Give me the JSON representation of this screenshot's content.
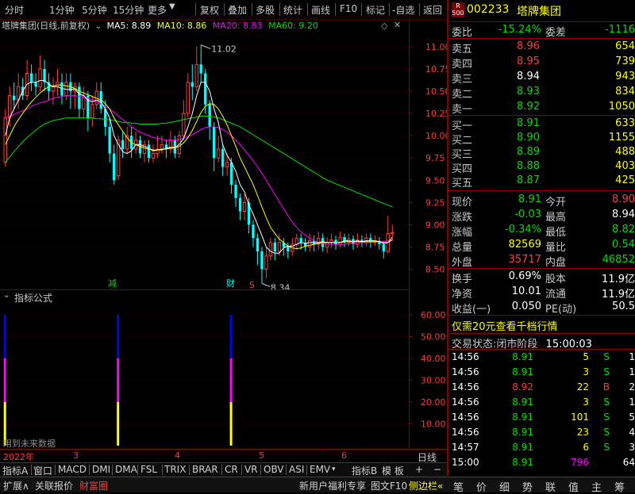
{
  "toolbar": {
    "left_items": [
      "分时",
      "1分钟",
      "5分钟",
      "15分钟",
      "更多"
    ],
    "right_items": [
      "复权",
      "叠加",
      "多股",
      "统计",
      "画线",
      "F10",
      "标记",
      "-自选",
      "返回"
    ]
  },
  "kline": {
    "name_label": "塔牌集团(日线,前复权)",
    "ma5": "MA5: 8.89",
    "ma10": "MA10: 8.86",
    "ma20": "MA20: 8.83",
    "ma60": "MA60: 9.20",
    "high_label": "11.02",
    "low_label": "8.34",
    "marker_jian": "减",
    "marker_cai": "财",
    "marker_s": "S",
    "colors": {
      "ma5": "#ffffff",
      "ma10": "#ffff00",
      "ma20": "#ff00ff",
      "ma60": "#00e000",
      "up": "#ff3c3c",
      "down": "#00ffff"
    }
  },
  "chart_data": {
    "type": "candlestick",
    "ylim": [
      8.3,
      11.15
    ],
    "yticks": [
      "11.00",
      "10.75",
      "10.50",
      "10.25",
      "10.00",
      "9.75",
      "9.50",
      "9.25",
      "9.00",
      "8.75",
      "8.50"
    ],
    "candles": [
      [
        9.7,
        10.2,
        10.3,
        9.65
      ],
      [
        10.2,
        10.45,
        10.55,
        10.1
      ],
      [
        10.45,
        10.4,
        10.6,
        10.3
      ],
      [
        10.4,
        10.55,
        10.7,
        10.3
      ],
      [
        10.55,
        10.45,
        10.65,
        10.4
      ],
      [
        10.45,
        10.7,
        10.85,
        10.4
      ],
      [
        10.7,
        10.6,
        10.8,
        10.5
      ],
      [
        10.6,
        10.55,
        10.7,
        10.45
      ],
      [
        10.55,
        10.75,
        10.9,
        10.5
      ],
      [
        10.75,
        10.6,
        10.85,
        10.5
      ],
      [
        10.6,
        10.5,
        10.7,
        10.4
      ],
      [
        10.5,
        10.55,
        10.65,
        10.35
      ],
      [
        10.55,
        10.6,
        10.75,
        10.45
      ],
      [
        10.6,
        10.45,
        10.7,
        10.35
      ],
      [
        10.45,
        10.6,
        10.7,
        10.4
      ],
      [
        10.6,
        10.5,
        10.7,
        10.3
      ],
      [
        10.5,
        10.55,
        10.6,
        10.3
      ],
      [
        10.55,
        10.3,
        10.6,
        10.2
      ],
      [
        10.3,
        10.45,
        10.55,
        10.2
      ],
      [
        10.45,
        10.2,
        10.5,
        10.05
      ],
      [
        10.2,
        10.35,
        10.45,
        10.1
      ],
      [
        10.35,
        10.5,
        10.6,
        10.3
      ],
      [
        10.5,
        10.3,
        10.6,
        10.25
      ],
      [
        10.3,
        10.1,
        10.4,
        10.0
      ],
      [
        10.1,
        9.8,
        10.2,
        9.7
      ],
      [
        9.8,
        9.5,
        9.9,
        9.45
      ],
      [
        9.55,
        9.95,
        10.0,
        9.5
      ],
      [
        9.95,
        9.85,
        10.05,
        9.75
      ],
      [
        9.85,
        10.0,
        10.1,
        9.8
      ],
      [
        10.0,
        9.85,
        10.1,
        9.75
      ],
      [
        9.85,
        9.95,
        10.05,
        9.8
      ],
      [
        9.95,
        9.8,
        10.0,
        9.75
      ],
      [
        9.8,
        9.9,
        9.95,
        9.7
      ],
      [
        9.9,
        9.75,
        9.95,
        9.7
      ],
      [
        9.75,
        9.8,
        9.9,
        9.7
      ],
      [
        9.8,
        9.85,
        10.0,
        9.75
      ],
      [
        9.85,
        9.9,
        10.0,
        9.8
      ],
      [
        9.9,
        9.85,
        9.95,
        9.75
      ],
      [
        9.85,
        9.95,
        10.05,
        9.8
      ],
      [
        9.95,
        9.8,
        10.0,
        9.75
      ],
      [
        9.8,
        10.0,
        10.05,
        9.75
      ],
      [
        10.0,
        10.25,
        10.4,
        9.95
      ],
      [
        10.25,
        10.6,
        10.7,
        10.2
      ],
      [
        10.6,
        10.55,
        10.8,
        10.4
      ],
      [
        10.55,
        10.8,
        11.0,
        10.5
      ],
      [
        10.8,
        10.7,
        11.02,
        10.6
      ],
      [
        10.7,
        10.35,
        10.75,
        10.25
      ],
      [
        10.35,
        10.1,
        10.4,
        9.95
      ],
      [
        10.1,
        9.75,
        10.15,
        9.6
      ],
      [
        9.75,
        9.85,
        10.0,
        9.7
      ],
      [
        9.85,
        9.65,
        9.9,
        9.55
      ],
      [
        9.65,
        9.7,
        9.8,
        9.55
      ],
      [
        9.7,
        9.45,
        9.75,
        9.35
      ],
      [
        9.45,
        9.3,
        9.5,
        9.2
      ],
      [
        9.3,
        9.15,
        9.35,
        9.05
      ],
      [
        9.15,
        9.25,
        9.35,
        9.05
      ],
      [
        9.25,
        9.0,
        9.3,
        8.9
      ],
      [
        9.0,
        8.85,
        9.05,
        8.75
      ],
      [
        8.85,
        8.7,
        8.9,
        8.55
      ],
      [
        8.7,
        8.5,
        8.75,
        8.34
      ],
      [
        8.5,
        8.65,
        8.75,
        8.4
      ],
      [
        8.65,
        8.8,
        8.85,
        8.6
      ],
      [
        8.8,
        8.7,
        8.85,
        8.6
      ],
      [
        8.7,
        8.8,
        8.9,
        8.65
      ],
      [
        8.8,
        8.75,
        8.85,
        8.65
      ],
      [
        8.75,
        8.7,
        8.8,
        8.62
      ],
      [
        8.7,
        8.78,
        8.85,
        8.65
      ],
      [
        8.78,
        8.85,
        8.9,
        8.72
      ],
      [
        8.85,
        8.8,
        8.9,
        8.72
      ],
      [
        8.8,
        8.75,
        8.85,
        8.7
      ],
      [
        8.75,
        8.82,
        8.9,
        8.7
      ],
      [
        8.82,
        8.78,
        8.88,
        8.7
      ],
      [
        8.78,
        8.85,
        8.92,
        8.72
      ],
      [
        8.85,
        8.75,
        8.9,
        8.7
      ],
      [
        8.75,
        8.8,
        8.86,
        8.68
      ],
      [
        8.8,
        8.83,
        8.9,
        8.74
      ],
      [
        8.83,
        8.78,
        8.88,
        8.72
      ],
      [
        8.78,
        8.86,
        8.92,
        8.74
      ],
      [
        8.86,
        8.8,
        8.9,
        8.75
      ],
      [
        8.8,
        8.84,
        8.9,
        8.76
      ],
      [
        8.84,
        8.78,
        8.88,
        8.72
      ],
      [
        8.78,
        8.83,
        8.9,
        8.74
      ],
      [
        8.83,
        8.8,
        8.88,
        8.75
      ],
      [
        8.8,
        8.85,
        8.9,
        8.76
      ],
      [
        8.85,
        8.8,
        8.9,
        8.74
      ],
      [
        8.8,
        8.82,
        8.88,
        8.76
      ],
      [
        8.82,
        8.78,
        8.86,
        8.72
      ],
      [
        8.78,
        8.7,
        8.82,
        8.62
      ],
      [
        8.7,
        8.9,
        9.1,
        8.68
      ],
      [
        8.9,
        8.91,
        9.0,
        8.82
      ]
    ],
    "ma5": [
      10.0,
      10.2,
      10.3,
      10.4,
      10.5,
      10.58,
      10.6,
      10.6,
      10.62,
      10.62,
      10.58,
      10.55,
      10.55,
      10.53,
      10.52,
      10.52,
      10.52,
      10.47,
      10.45,
      10.4,
      10.38,
      10.4,
      10.38,
      10.3,
      10.2,
      10.0,
      9.9,
      9.82,
      9.8,
      9.83,
      9.9,
      9.9,
      9.88,
      9.86,
      9.83,
      9.84,
      9.84,
      9.86,
      9.87,
      9.87,
      9.9,
      9.97,
      10.1,
      10.25,
      10.45,
      10.6,
      10.6,
      10.5,
      10.3,
      10.15,
      9.9,
      9.78,
      9.7,
      9.6,
      9.45,
      9.37,
      9.22,
      9.12,
      9.0,
      8.88,
      8.75,
      8.7,
      8.68,
      8.68,
      8.74,
      8.76,
      8.76,
      8.78,
      8.8,
      8.79,
      8.8,
      8.8,
      8.8,
      8.81,
      8.8,
      8.8,
      8.8,
      8.8,
      8.82,
      8.82,
      8.81,
      8.82,
      8.81,
      8.82,
      8.82,
      8.82,
      8.81,
      8.79,
      8.8,
      8.83
    ],
    "ma10": [
      9.9,
      10.0,
      10.1,
      10.18,
      10.25,
      10.32,
      10.38,
      10.43,
      10.48,
      10.52,
      10.55,
      10.56,
      10.57,
      10.57,
      10.56,
      10.55,
      10.53,
      10.5,
      10.48,
      10.46,
      10.44,
      10.42,
      10.4,
      10.36,
      10.3,
      10.2,
      10.12,
      10.05,
      9.98,
      9.92,
      9.9,
      9.88,
      9.86,
      9.85,
      9.84,
      9.84,
      9.85,
      9.85,
      9.86,
      9.86,
      9.88,
      9.92,
      9.98,
      10.06,
      10.16,
      10.26,
      10.33,
      10.36,
      10.35,
      10.3,
      10.22,
      10.12,
      10.0,
      9.88,
      9.75,
      9.65,
      9.55,
      9.45,
      9.33,
      9.2,
      9.08,
      8.97,
      8.9,
      8.84,
      8.8,
      8.76,
      8.74,
      8.73,
      8.74,
      8.76,
      8.77,
      8.78,
      8.79,
      8.8,
      8.8,
      8.8,
      8.8,
      8.8,
      8.81,
      8.81,
      8.81,
      8.81,
      8.81,
      8.81,
      8.81,
      8.81,
      8.81,
      8.8,
      8.8,
      8.86
    ],
    "ma20": [
      10.2,
      10.22,
      10.24,
      10.26,
      10.28,
      10.3,
      10.33,
      10.35,
      10.37,
      10.38,
      10.4,
      10.42,
      10.43,
      10.44,
      10.45,
      10.45,
      10.45,
      10.44,
      10.43,
      10.42,
      10.4,
      10.38,
      10.36,
      10.33,
      10.3,
      10.26,
      10.22,
      10.18,
      10.14,
      10.1,
      10.07,
      10.04,
      10.02,
      10.0,
      9.98,
      9.97,
      9.96,
      9.95,
      9.95,
      9.95,
      9.96,
      9.97,
      9.99,
      10.01,
      10.04,
      10.07,
      10.09,
      10.1,
      10.1,
      10.09,
      10.07,
      10.04,
      10.0,
      9.95,
      9.9,
      9.84,
      9.78,
      9.72,
      9.65,
      9.58,
      9.5,
      9.42,
      9.34,
      9.26,
      9.18,
      9.1,
      9.03,
      8.97,
      8.92,
      8.88,
      8.85,
      8.82,
      8.8,
      8.79,
      8.78,
      8.78,
      8.78,
      8.78,
      8.78,
      8.79,
      8.79,
      8.8,
      8.8,
      8.8,
      8.8,
      8.81,
      8.81,
      8.81,
      8.82,
      8.83
    ],
    "ma60": [
      9.7,
      9.76,
      9.82,
      9.88,
      9.93,
      9.98,
      10.02,
      10.06,
      10.1,
      10.13,
      10.15,
      10.17,
      10.18,
      10.19,
      10.2,
      10.2,
      10.2,
      10.2,
      10.2,
      10.2,
      10.2,
      10.19,
      10.19,
      10.18,
      10.18,
      10.17,
      10.16,
      10.15,
      10.15,
      10.14,
      10.14,
      10.13,
      10.13,
      10.13,
      10.13,
      10.13,
      10.14,
      10.14,
      10.15,
      10.16,
      10.17,
      10.18,
      10.19,
      10.2,
      10.21,
      10.22,
      10.22,
      10.22,
      10.21,
      10.2,
      10.18,
      10.16,
      10.14,
      10.12,
      10.1,
      10.07,
      10.04,
      10.01,
      9.98,
      9.95,
      9.92,
      9.89,
      9.86,
      9.83,
      9.8,
      9.77,
      9.74,
      9.71,
      9.68,
      9.65,
      9.62,
      9.59,
      9.56,
      9.53,
      9.5,
      9.48,
      9.46,
      9.44,
      9.42,
      9.4,
      9.38,
      9.36,
      9.34,
      9.32,
      9.3,
      9.28,
      9.26,
      9.24,
      9.22,
      9.2
    ],
    "indicator": {
      "yticks": [
        "60.00",
        "50.00",
        "40.00",
        "30.00",
        "20.00",
        "10.00"
      ],
      "ylim": [
        0,
        64
      ],
      "bars": [
        {
          "x": 0,
          "segments": [
            {
              "from": 0,
              "to": 20,
              "color": "#ffff00"
            },
            {
              "from": 20,
              "to": 40,
              "color": "#ff00ff"
            },
            {
              "from": 40,
              "to": 60,
              "color": "#0000ff"
            }
          ]
        },
        {
          "x": 26,
          "segments": [
            {
              "from": 0,
              "to": 20,
              "color": "#ffff00"
            },
            {
              "from": 20,
              "to": 40,
              "color": "#ff00ff"
            },
            {
              "from": 40,
              "to": 60,
              "color": "#0000ff"
            }
          ]
        },
        {
          "x": 52,
          "segments": [
            {
              "from": 0,
              "to": 20,
              "color": "#ffff00"
            },
            {
              "from": 20,
              "to": 40,
              "color": "#ff00ff"
            },
            {
              "from": 40,
              "to": 60,
              "color": "#0000ff"
            }
          ]
        }
      ]
    }
  },
  "indicator_panel": {
    "title": "指标公式",
    "footnote": "用到未来数据"
  },
  "date_axis": {
    "labels": [
      "2022年",
      "3",
      "4",
      "5",
      "6"
    ],
    "right_label": "日线"
  },
  "bottom_tabs": [
    "指标A",
    "窗口",
    "MACD",
    "DMI",
    "DMA",
    "FSL",
    "TRIX",
    "BRAR",
    "CR",
    "VR",
    "OBV",
    "ASI",
    "EMV",
    "指标B",
    "模 板",
    "+",
    "−"
  ],
  "status_bar": {
    "left": [
      "扩展∧",
      "关联报价",
      "财富圈"
    ],
    "right_links": [
      "新用户福利专享",
      "图文F10",
      "侧边栏«"
    ],
    "side_icons": [
      "笔",
      "价",
      "细",
      "势",
      "联",
      "值",
      "主",
      "筹"
    ]
  },
  "quote": {
    "badge_top": "R",
    "badge_bottom": "500",
    "code": "002233",
    "name": "塔牌集团",
    "weibi_label": "委比",
    "weibi_value": "-15.24%",
    "weicha_label": "委差",
    "weicha_value": "-1116",
    "asks": [
      {
        "label": "卖五",
        "price": "8.96",
        "vol": "654"
      },
      {
        "label": "卖四",
        "price": "8.95",
        "vol": "739"
      },
      {
        "label": "卖三",
        "price": "8.94",
        "vol": "943"
      },
      {
        "label": "卖二",
        "price": "8.93",
        "vol": "834"
      },
      {
        "label": "卖一",
        "price": "8.92",
        "vol": "1050"
      }
    ],
    "bids": [
      {
        "label": "买一",
        "price": "8.91",
        "vol": "633"
      },
      {
        "label": "买二",
        "price": "8.90",
        "vol": "1155"
      },
      {
        "label": "买三",
        "price": "8.89",
        "vol": "488"
      },
      {
        "label": "买四",
        "price": "8.88",
        "vol": "403"
      },
      {
        "label": "买五",
        "price": "8.87",
        "vol": "425"
      }
    ],
    "stats": [
      {
        "l1": "现价",
        "v1": "8.91",
        "l2": "今开",
        "v2": "8.90"
      },
      {
        "l1": "涨跌",
        "v1": "-0.03",
        "l2": "最高",
        "v2": "8.94"
      },
      {
        "l1": "涨幅",
        "v1": "-0.34%",
        "l2": "最低",
        "v2": "8.82"
      },
      {
        "l1": "总量",
        "v1": "82569",
        "l2": "量比",
        "v2": "0.54"
      },
      {
        "l1": "外盘",
        "v1": "35717",
        "l2": "内盘",
        "v2": "46852"
      }
    ],
    "fund": [
      {
        "l1": "换手",
        "v1": "0.69%",
        "l2": "股本",
        "v2": "11.9亿"
      },
      {
        "l1": "净资",
        "v1": "10.01",
        "l2": "流通",
        "v2": "11.9亿"
      },
      {
        "l1": "收益(一)",
        "v1": "0.050",
        "l2": "PE(动)",
        "v2": "50.5"
      }
    ],
    "promo": "仅需20元查看千档行情",
    "state_label": "交易状态:",
    "state_value": "闭市阶段",
    "state_time": "15:00:03",
    "ticks": [
      {
        "time": "14:56",
        "price": "8.91",
        "vol": "5",
        "side": "S",
        "n": "1"
      },
      {
        "time": "14:56",
        "price": "8.91",
        "vol": "3",
        "side": "S",
        "n": "1"
      },
      {
        "time": "14:56",
        "price": "8.92",
        "vol": "22",
        "side": "B",
        "n": "2"
      },
      {
        "time": "14:56",
        "price": "8.91",
        "vol": "3",
        "side": "S",
        "n": "1"
      },
      {
        "time": "14:56",
        "price": "8.91",
        "vol": "101",
        "side": "S",
        "n": "5"
      },
      {
        "time": "14:56",
        "price": "8.91",
        "vol": "23",
        "side": "S",
        "n": "4"
      },
      {
        "time": "14:57",
        "price": "8.91",
        "vol": "6",
        "side": "S",
        "n": "3"
      },
      {
        "time": "15:00",
        "price": "8.91",
        "vol": "796",
        "side": "",
        "n": "64"
      }
    ]
  }
}
